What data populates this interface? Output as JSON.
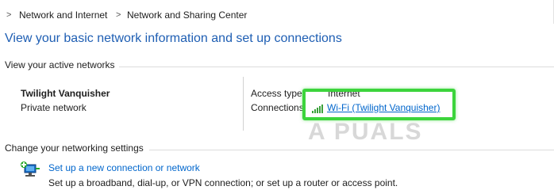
{
  "breadcrumb": {
    "items": [
      "Network and Internet",
      "Network and Sharing Center"
    ],
    "separator": ">"
  },
  "page": {
    "title": "View your basic network information and set up connections"
  },
  "active_networks": {
    "header": "View your active networks",
    "network_name": "Twilight Vanquisher",
    "network_type": "Private network",
    "access_type_label": "Access type:",
    "access_type_value": "Internet",
    "connections_label": "Connections:",
    "connection_link": "Wi-Fi (Twilight Vanquisher)",
    "connection_icon": "wifi-signal-icon"
  },
  "networking_settings": {
    "header": "Change your networking settings",
    "tasks": [
      {
        "label": "Set up a new connection or network",
        "description": "Set up a broadband, dial-up, or VPN connection; or set up a router or access point.",
        "icon": "network-setup-icon"
      }
    ]
  },
  "watermark": "A PUALS",
  "colors": {
    "title": "#1e5eb3",
    "link": "#0066cc",
    "highlight": "#3cd43c"
  }
}
